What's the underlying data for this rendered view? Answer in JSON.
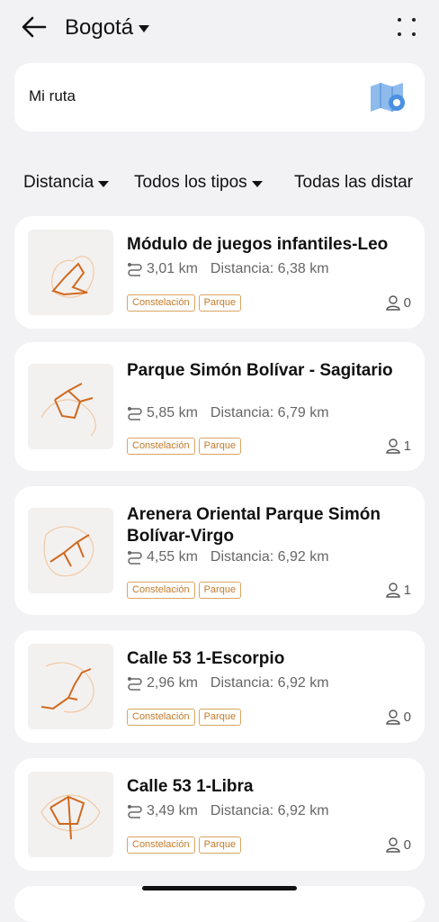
{
  "header": {
    "city": "Bogotá",
    "back_icon": "arrow-left-icon",
    "more_icon": "grid-dots-icon"
  },
  "route_card": {
    "label": "Mi ruta",
    "icon": "map-icon",
    "icon_color": "#4a90e2"
  },
  "filters": [
    {
      "label": "Distancia"
    },
    {
      "label": "Todos los tipos"
    },
    {
      "label": "Todas las distar"
    }
  ],
  "colors": {
    "accent": "#c47a2b",
    "thumb_line": "#d0691f",
    "background": "#f2f2f4"
  },
  "routes": [
    {
      "title": "Módulo de juegos infantiles-Leo",
      "length": "3,01 km",
      "distance": "Distancia: 6,38 km",
      "tags": [
        "Constelación",
        "Parque"
      ],
      "users": "0"
    },
    {
      "title": "Parque Simón Bolívar - Sagitario",
      "length": "5,85 km",
      "distance": "Distancia: 6,79 km",
      "tags": [
        "Constelación",
        "Parque"
      ],
      "users": "1"
    },
    {
      "title": "Arenera Oriental Parque Simón Bolívar-Virgo",
      "length": "4,55 km",
      "distance": "Distancia: 6,92 km",
      "tags": [
        "Constelación",
        "Parque"
      ],
      "users": "1"
    },
    {
      "title": "Calle 53 1-Escorpio",
      "length": "2,96 km",
      "distance": "Distancia: 6,92 km",
      "tags": [
        "Constelación",
        "Parque"
      ],
      "users": "0"
    },
    {
      "title": "Calle 53 1-Libra",
      "length": "3,49 km",
      "distance": "Distancia: 6,92 km",
      "tags": [
        "Constelación",
        "Parque"
      ],
      "users": "0"
    }
  ]
}
